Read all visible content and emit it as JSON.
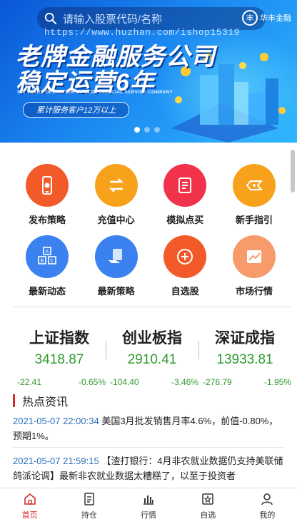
{
  "banner": {
    "search_placeholder": "请输入股票代码/名称",
    "logo_mark": "丰",
    "logo_text": "华丰金融",
    "watermark": "https://www.huzhan.com/ishop15319",
    "headline_line1": "老牌金融服务公司",
    "headline_line2": "稳定运营6年",
    "subline": "SIX YEARS OPERATION OF OLD FINANCIAL SERVICE COMPANY",
    "pill_text": "累计服务客户12万以上",
    "carousel_active_index": 0
  },
  "menu": {
    "row1": [
      {
        "label": "发布策略",
        "icon": "phone-gear-icon",
        "color": "#f35a2a"
      },
      {
        "label": "充值中心",
        "icon": "transfer-icon",
        "color": "#f7a21a"
      },
      {
        "label": "模拟点买",
        "icon": "document-icon",
        "color": "#f0334a"
      },
      {
        "label": "新手指引",
        "icon": "signpost-icon",
        "color": "#f7a21a"
      }
    ],
    "row2": [
      {
        "label": "最新动态",
        "icon": "abc-blocks-icon",
        "color": "#3b82f0"
      },
      {
        "label": "最新策略",
        "icon": "hand-document-icon",
        "color": "#3b82f0"
      },
      {
        "label": "自选股",
        "icon": "plus-circle-icon",
        "color": "#f35a2a"
      },
      {
        "label": "市场行情",
        "icon": "chart-trend-icon",
        "color": "#f79b6b"
      }
    ]
  },
  "indices": [
    {
      "name": "上证指数",
      "value": "3418.87",
      "change": "-22.41",
      "percent": "-0.65%"
    },
    {
      "name": "创业板指",
      "value": "2910.41",
      "change": "-104.40",
      "percent": "-3.46%"
    },
    {
      "name": "深证成指",
      "value": "13933.81",
      "change": "-276.79",
      "percent": "-1.95%"
    }
  ],
  "news": {
    "title": "热点资讯",
    "items": [
      {
        "time": "2021-05-07 22:00:34",
        "text": " 美国3月批发销售月率4.6%，前值-0.80%，预期1%。"
      },
      {
        "time": "2021-05-07 21:59:15",
        "text": " 【渣打银行：4月非农就业数据仍支持美联储鸽派论调】最新非农就业数据太糟糕了，以至于投资者"
      }
    ]
  },
  "tabbar": [
    {
      "label": "首页",
      "icon": "home-icon",
      "active": true
    },
    {
      "label": "持仓",
      "icon": "holdings-icon",
      "active": false
    },
    {
      "label": "行情",
      "icon": "bar-chart-icon",
      "active": false
    },
    {
      "label": "自选",
      "icon": "star-box-icon",
      "active": false
    },
    {
      "label": "我的",
      "icon": "user-icon",
      "active": false
    }
  ],
  "colors": {
    "accent_red": "#d72b2b",
    "index_green": "#2e9a2e",
    "time_blue": "#2a6fb8"
  }
}
